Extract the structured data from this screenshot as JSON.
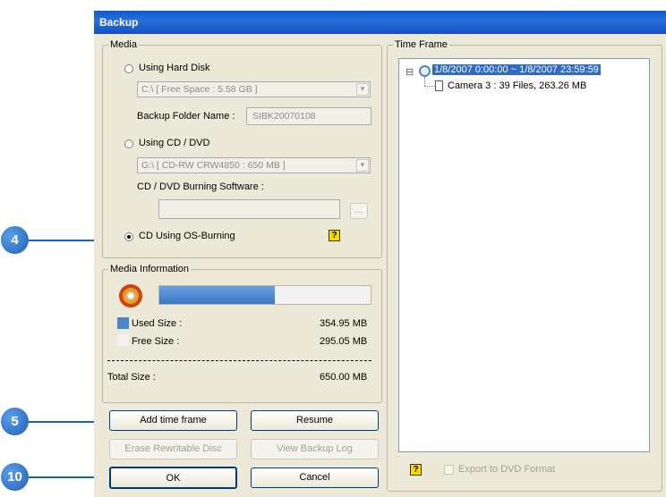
{
  "window": {
    "title": "Backup"
  },
  "media": {
    "legend": "Media",
    "hard_disk": {
      "label": "Using Hard Disk",
      "drive": "C:\\ [ Free Space : 5.58 GB ]",
      "folder_label": "Backup Folder Name :",
      "folder_value": "SIBK20070108"
    },
    "cd_dvd": {
      "label": "Using CD / DVD",
      "drive": "G:\\ [ CD-RW CRW4850 : 650 MB ]",
      "software_label": "CD / DVD Burning Software :",
      "software_value": "",
      "browse_label": "..."
    },
    "os_burning": {
      "label": "CD Using OS-Burning"
    }
  },
  "media_info": {
    "legend": "Media Information",
    "used_fraction": 0.546,
    "used_label": "Used Size :",
    "used_value": "354.95 MB",
    "free_label": "Free Size :",
    "free_value": "295.05 MB",
    "total_label": "Total Size :",
    "total_value": "650.00 MB",
    "used_color": "#4a86c8",
    "free_color": "#f2f2f2"
  },
  "buttons": {
    "add_time_frame": "Add time frame",
    "resume": "Resume",
    "erase": "Erase Rewritable Disc",
    "view_log": "View Backup Log",
    "ok": "OK",
    "cancel": "Cancel"
  },
  "time_frame": {
    "legend": "Time Frame",
    "root": "1/8/2007 0:00:00 ~ 1/8/2007 23:59:59",
    "child": "Camera 3 : 39 Files, 263.26 MB",
    "expander": "⊟"
  },
  "export": {
    "label": "Export to DVD Format"
  },
  "help_icon": "?",
  "callouts": {
    "four": "4",
    "five": "5",
    "ten": "10"
  }
}
